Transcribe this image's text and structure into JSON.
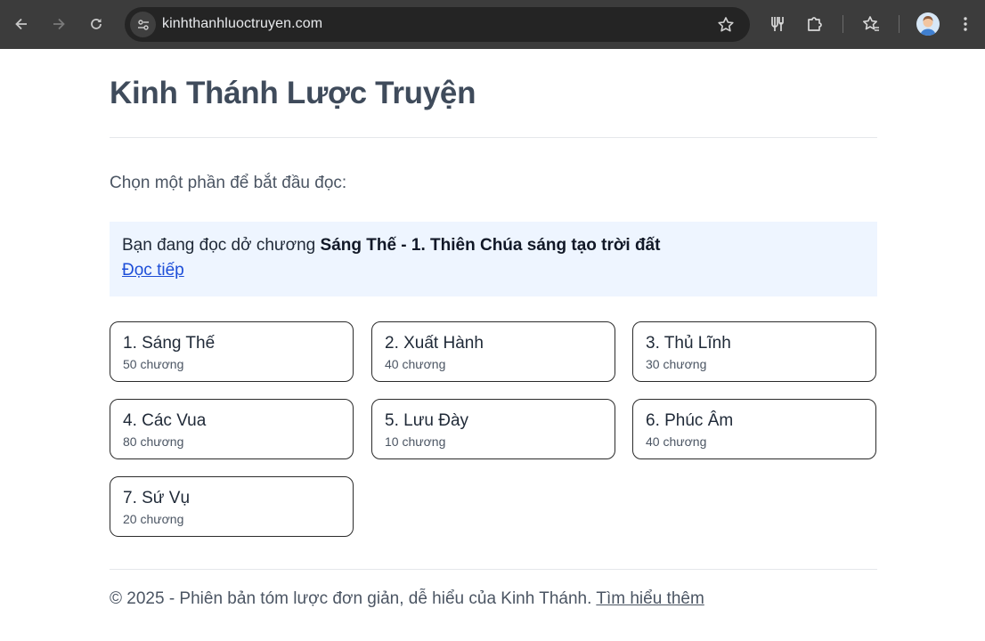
{
  "browser": {
    "url": "kinhthanhluoctruyen.com"
  },
  "page": {
    "title": "Kinh Thánh Lược Truyện",
    "intro": "Chọn một phần để bắt đầu đọc:",
    "resume": {
      "prefix": "Bạn đang đọc dở chương ",
      "chapter": "Sáng Thế - 1. Thiên Chúa sáng tạo trời đất",
      "link": "Đọc tiếp"
    },
    "sections": [
      {
        "title": "1. Sáng Thế",
        "chapters": "50 chương"
      },
      {
        "title": "2. Xuất Hành",
        "chapters": "40 chương"
      },
      {
        "title": "3. Thủ Lĩnh",
        "chapters": "30 chương"
      },
      {
        "title": "4. Các Vua",
        "chapters": "80 chương"
      },
      {
        "title": "5. Lưu Đày",
        "chapters": "10 chương"
      },
      {
        "title": "6. Phúc Âm",
        "chapters": "40 chương"
      },
      {
        "title": "7. Sứ Vụ",
        "chapters": "20 chương"
      }
    ],
    "footer": {
      "text": "© 2025 - Phiên bản tóm lược đơn giản, dễ hiểu của Kinh Thánh. ",
      "link": "Tìm hiểu thêm"
    }
  }
}
